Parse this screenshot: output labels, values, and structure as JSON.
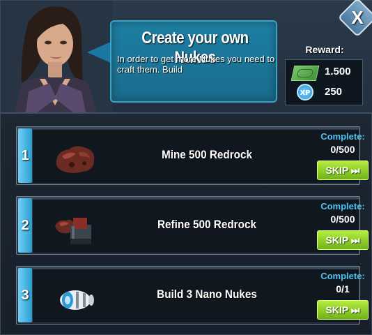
{
  "dialog": {
    "close_label": "X",
    "title": "Create your own Nukes",
    "description": "In order to get more Nukes you need to craft them. Build",
    "reward_label": "Reward:",
    "rewards": [
      {
        "icon": "cash-icon",
        "value": "1.500"
      },
      {
        "icon": "xp-icon",
        "icon_label": "XP",
        "value": "250"
      }
    ]
  },
  "tasks": [
    {
      "number": "1",
      "icon": "redrock-ore-icon",
      "name": "Mine 500 Redrock",
      "complete_label": "Complete:",
      "progress": "0/500",
      "skip_label": "SKIP ⏭"
    },
    {
      "number": "2",
      "icon": "refinery-icon",
      "name": "Refine 500 Redrock",
      "complete_label": "Complete:",
      "progress": "0/500",
      "skip_label": "SKIP ⏭"
    },
    {
      "number": "3",
      "icon": "nano-nuke-icon",
      "name": "Build 3 Nano Nukes",
      "complete_label": "Complete:",
      "progress": "0/1",
      "skip_label": "SKIP ⏭"
    }
  ],
  "colors": {
    "accent_blue": "#4fc3f0",
    "skip_green": "#8fd22a",
    "speech_blue": "#1c78a0"
  }
}
